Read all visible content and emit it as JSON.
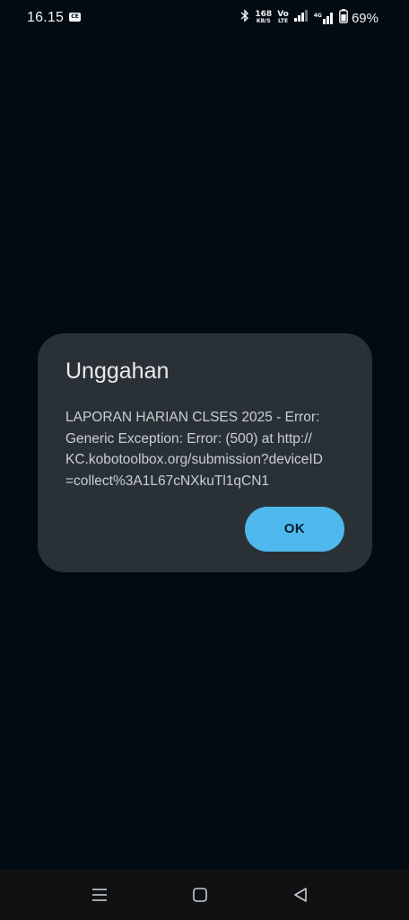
{
  "status_bar": {
    "time": "16.15",
    "notification_icon": "CE",
    "network_speed_value": "168",
    "network_speed_unit": "KB/S",
    "volte_top": "Vo",
    "volte_bottom": "LTE",
    "network_type": "4G",
    "battery_percent": "69%"
  },
  "dialog": {
    "title": "Unggahan",
    "message": "LAPORAN HARIAN CLSES 2025 - Error:\nGeneric Exception: Error:  (500) at http://\nKC.kobotoolbox.org/submission?deviceID\n=collect%3A1L67cNXkuTl1qCN1",
    "ok_label": "OK"
  },
  "colors": {
    "background": "#030b12",
    "dialog_background": "#2a3136",
    "ok_button": "#4fb8ec",
    "nav_bar": "#0f1113"
  },
  "nav_bar": {
    "icons": [
      "recents-menu-icon",
      "home-icon",
      "back-icon"
    ]
  }
}
